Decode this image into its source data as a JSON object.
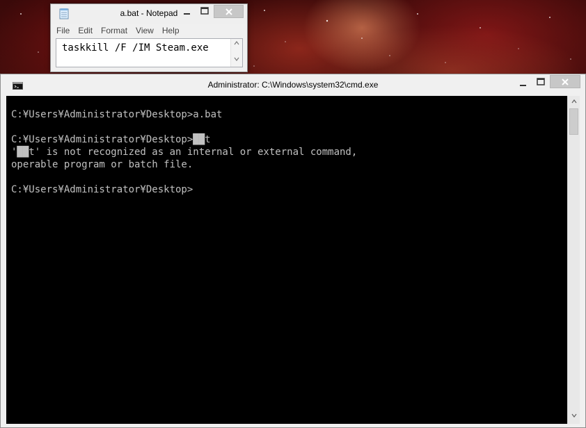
{
  "notepad": {
    "title": "a.bat - Notepad",
    "menu": [
      "File",
      "Edit",
      "Format",
      "View",
      "Help"
    ],
    "content": "taskkill /F /IM Steam.exe"
  },
  "cmd": {
    "title": "Administrator: C:\\Windows\\system32\\cmd.exe",
    "lines": [
      "C:¥Users¥Administrator¥Desktop>a.bat",
      "",
      "C:¥Users¥Administrator¥Desktop>██t",
      "'██t' is not recognized as an internal or external command,",
      "operable program or batch file.",
      "",
      "C:¥Users¥Administrator¥Desktop>"
    ]
  },
  "colors": {
    "console_bg": "#000000",
    "console_fg": "#c0c0c0",
    "close_button_bg": "#c7c7c7",
    "window_chrome": "#f0f0f0"
  },
  "icons": {
    "notepad_app": "notepad-icon",
    "cmd_app": "cmd-icon",
    "minimize": "minimize-icon",
    "maximize": "maximize-icon",
    "close": "close-icon"
  }
}
